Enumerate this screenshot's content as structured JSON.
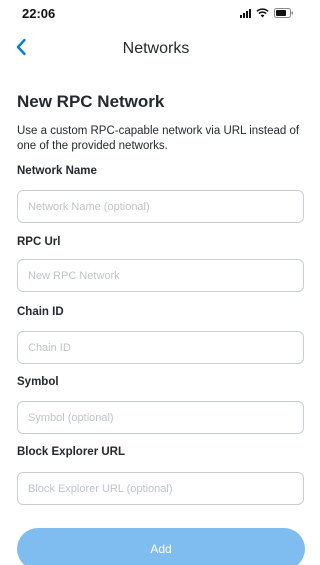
{
  "status_bar": {
    "time": "22:06",
    "icons": [
      "signal-icon",
      "wifi-icon",
      "battery-icon"
    ]
  },
  "nav": {
    "back_icon": "chevron-left-icon",
    "title": "Networks"
  },
  "form": {
    "title": "New RPC Network",
    "description": "Use a custom RPC-capable network via URL instead of one of the provided networks.",
    "fields": [
      {
        "label": "Network Name",
        "value": "",
        "placeholder": "Network Name (optional)"
      },
      {
        "label": "RPC Url",
        "value": "",
        "placeholder": "New RPC Network"
      },
      {
        "label": "Chain ID",
        "value": "",
        "placeholder": "Chain ID"
      },
      {
        "label": "Symbol",
        "value": "",
        "placeholder": "Symbol (optional)"
      },
      {
        "label": "Block Explorer URL",
        "value": "",
        "placeholder": "Block Explorer URL (optional)"
      }
    ],
    "submit_label": "Add"
  },
  "colors": {
    "accent": "#037dd6",
    "button_disabled": "#7fbdf0",
    "input_border": "#c9ced3",
    "text": "#24292e",
    "placeholder": "#bfc3c8"
  }
}
